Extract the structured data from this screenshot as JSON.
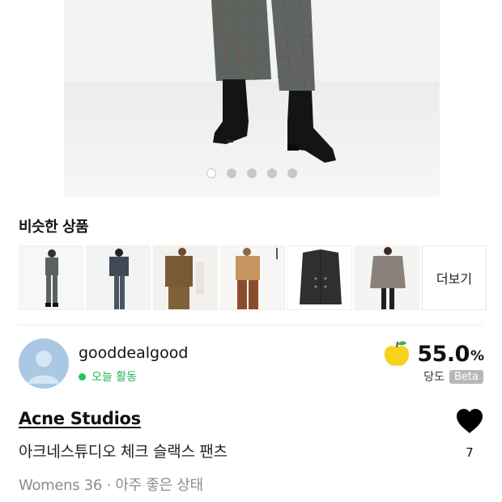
{
  "gallery": {
    "dots": [
      true,
      false,
      false,
      false,
      false
    ]
  },
  "similar": {
    "title": "비슷한 상품",
    "items": [
      {
        "icon": "similar-product-1"
      },
      {
        "icon": "similar-product-2"
      },
      {
        "icon": "similar-product-3"
      },
      {
        "icon": "similar-product-4"
      },
      {
        "icon": "similar-product-5"
      },
      {
        "icon": "similar-product-6"
      }
    ],
    "more_label": "더보기"
  },
  "seller": {
    "name": "gooddealgood",
    "activity": "오늘 활동",
    "activity_color": "#22c55e"
  },
  "sweetness": {
    "value": "55.0",
    "unit": "%",
    "label": "당도",
    "badge": "Beta",
    "icon": "yellow-apple-icon"
  },
  "product": {
    "brand": "Acne Studios",
    "name": "아크네스튜디오 체크 슬랙스 팬츠",
    "meta": "Womens 36 · 아주 좋은 상태",
    "likes": "7"
  }
}
